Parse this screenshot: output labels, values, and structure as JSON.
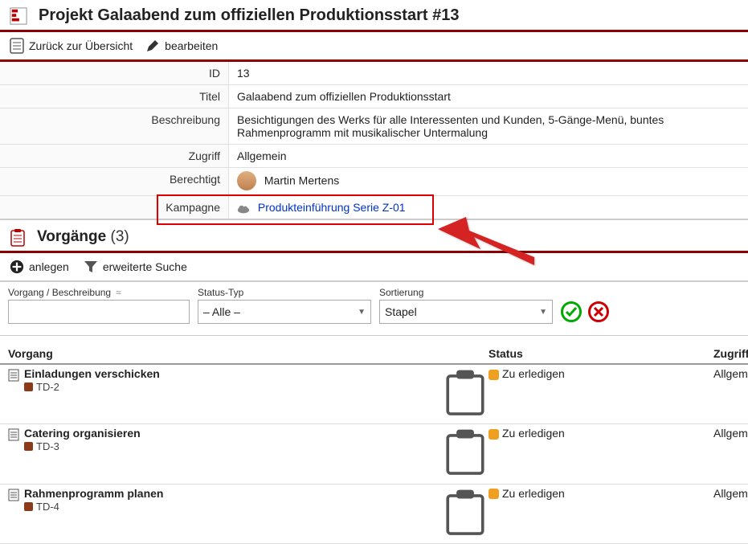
{
  "header": {
    "title": "Projekt Galaabend zum offiziellen Produktionsstart #13"
  },
  "toolbar": {
    "back_label": "Zurück zur Übersicht",
    "edit_label": "bearbeiten"
  },
  "details": {
    "id_label": "ID",
    "id_value": "13",
    "title_label": "Titel",
    "title_value": "Galaabend zum offiziellen Produktionsstart",
    "desc_label": "Beschreibung",
    "desc_value": "Besichtigungen des Werks für alle Interessenten und Kunden, 5-Gänge-Menü, buntes Rahmenprogramm mit musikalischer Untermalung",
    "access_label": "Zugriff",
    "access_value": "Allgemein",
    "auth_label": "Berechtigt",
    "auth_value": "Martin Mertens",
    "campaign_label": "Kampagne",
    "campaign_value": "Produkteinführung Serie Z-01"
  },
  "section": {
    "title": "Vorgänge",
    "count": "(3)"
  },
  "sub_toolbar": {
    "create_label": "anlegen",
    "adv_search_label": "erweiterte Suche"
  },
  "filters": {
    "vorgang_label": "Vorgang / Beschreibung",
    "approx": "≈",
    "status_label": "Status-Typ",
    "status_value": "– Alle –",
    "sort_label": "Sortierung",
    "sort_value": "Stapel"
  },
  "table": {
    "headers": {
      "vorgang": "Vorgang",
      "status": "Status",
      "zugriff": "Zugriff"
    },
    "rows": [
      {
        "title": "Einladungen verschicken",
        "sub": "TD-2",
        "status": "Zu erledigen",
        "zugriff": "Allgemein"
      },
      {
        "title": "Catering organisieren",
        "sub": "TD-3",
        "status": "Zu erledigen",
        "zugriff": "Allgemein"
      },
      {
        "title": "Rahmenprogramm planen",
        "sub": "TD-4",
        "status": "Zu erledigen",
        "zugriff": "Allgemein"
      }
    ]
  }
}
